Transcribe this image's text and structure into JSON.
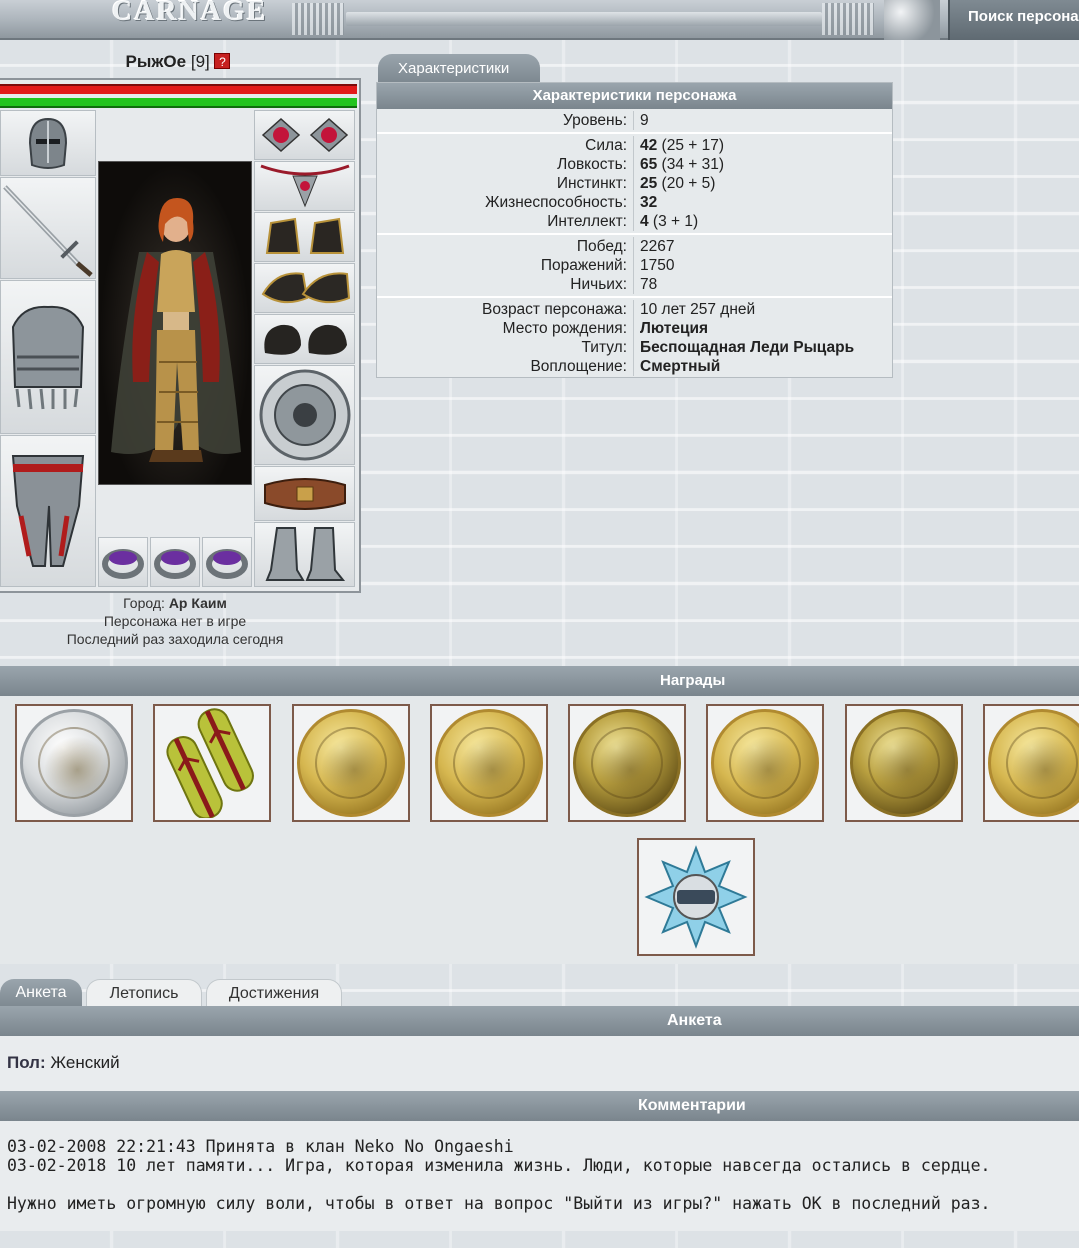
{
  "header": {
    "logo": "CARNAGE",
    "search_label": "Поиск персона"
  },
  "character": {
    "name": "РыжОе",
    "level_badge": "[9]",
    "info_icon": "?",
    "city_label": "Город:",
    "city": "Ар Каим",
    "status": "Персонажа нет в игре",
    "last_seen": "Последний раз заходила сегодня",
    "hp_fraction": 1.0,
    "mp_fraction": 1.0
  },
  "equipment": {
    "left_slots": [
      "helmet-icon",
      "sword-icon",
      "armor-icon",
      "leg-armor-icon"
    ],
    "right_slots": [
      "amulet-earrings-icon",
      "necklace-icon",
      "bracers-icon",
      "gauntlets-icon",
      "gloves-icon",
      "shield-icon",
      "belt-icon",
      "boots-icon"
    ],
    "ring_slots": [
      "ring-icon",
      "ring-icon",
      "ring-icon"
    ]
  },
  "characteristics": {
    "tab_label": "Характеристики",
    "panel_title": "Характеристики персонажа",
    "groups": [
      [
        {
          "label": "Уровень:",
          "value_bold": "",
          "value": "9"
        }
      ],
      [
        {
          "label": "Сила:",
          "value_bold": "42",
          "value": " (25 + 17)"
        },
        {
          "label": "Ловкость:",
          "value_bold": "65",
          "value": " (34 + 31)"
        },
        {
          "label": "Инстинкт:",
          "value_bold": "25",
          "value": " (20 + 5)"
        },
        {
          "label": "Жизнеспособность:",
          "value_bold": "32",
          "value": ""
        },
        {
          "label": "Интеллект:",
          "value_bold": "4",
          "value": " (3 + 1)"
        }
      ],
      [
        {
          "label": "Побед:",
          "value_bold": "",
          "value": "2267"
        },
        {
          "label": "Поражений:",
          "value_bold": "",
          "value": "1750"
        },
        {
          "label": "Ничьих:",
          "value_bold": "",
          "value": "78"
        }
      ],
      [
        {
          "label": "Возраст персонажа:",
          "value_bold": "",
          "value": "10 лет 257 дней"
        },
        {
          "label": "Место рождения:",
          "value_bold": "Лютеция",
          "value": ""
        },
        {
          "label": "Титул:",
          "value_bold": "Беспощадная Леди Рыцарь",
          "value": ""
        },
        {
          "label": "Воплощение:",
          "value_bold": "Смертный",
          "value": ""
        }
      ]
    ]
  },
  "awards": {
    "title": "Награды",
    "items": [
      {
        "icon": "silver-medal-icon",
        "style": "silver"
      },
      {
        "icon": "shoulder-straps-icon",
        "style": "straps"
      },
      {
        "icon": "gold-medal-icon",
        "style": "gold"
      },
      {
        "icon": "gold-medal-icon",
        "style": "gold"
      },
      {
        "icon": "gold-medal-icon",
        "style": "gold-dark"
      },
      {
        "icon": "gold-medal-icon",
        "style": "gold"
      },
      {
        "icon": "gold-medal-icon",
        "style": "gold-dark"
      },
      {
        "icon": "gold-medal-icon",
        "style": "gold"
      },
      {
        "icon": "snowflake-badge-icon",
        "style": "snowflake"
      }
    ]
  },
  "tabs": [
    "Анкета",
    "Летопись",
    "Достижения"
  ],
  "anketa": {
    "title": "Анкета",
    "gender_label": "Пол:",
    "gender_value": "Женский"
  },
  "comments": {
    "title": "Комментарии",
    "lines": [
      "03-02-2008 22:21:43 Принята в клан Neko No Ongaeshi",
      "03-02-2018 10 лет памяти... Игра, которая изменила жизнь. Люди, которые навсегда остались в сердце.",
      "Нужно иметь огромную силу воли, чтобы в ответ на вопрос \"Выйти из игры?\" нажать ОК в последний раз."
    ]
  }
}
